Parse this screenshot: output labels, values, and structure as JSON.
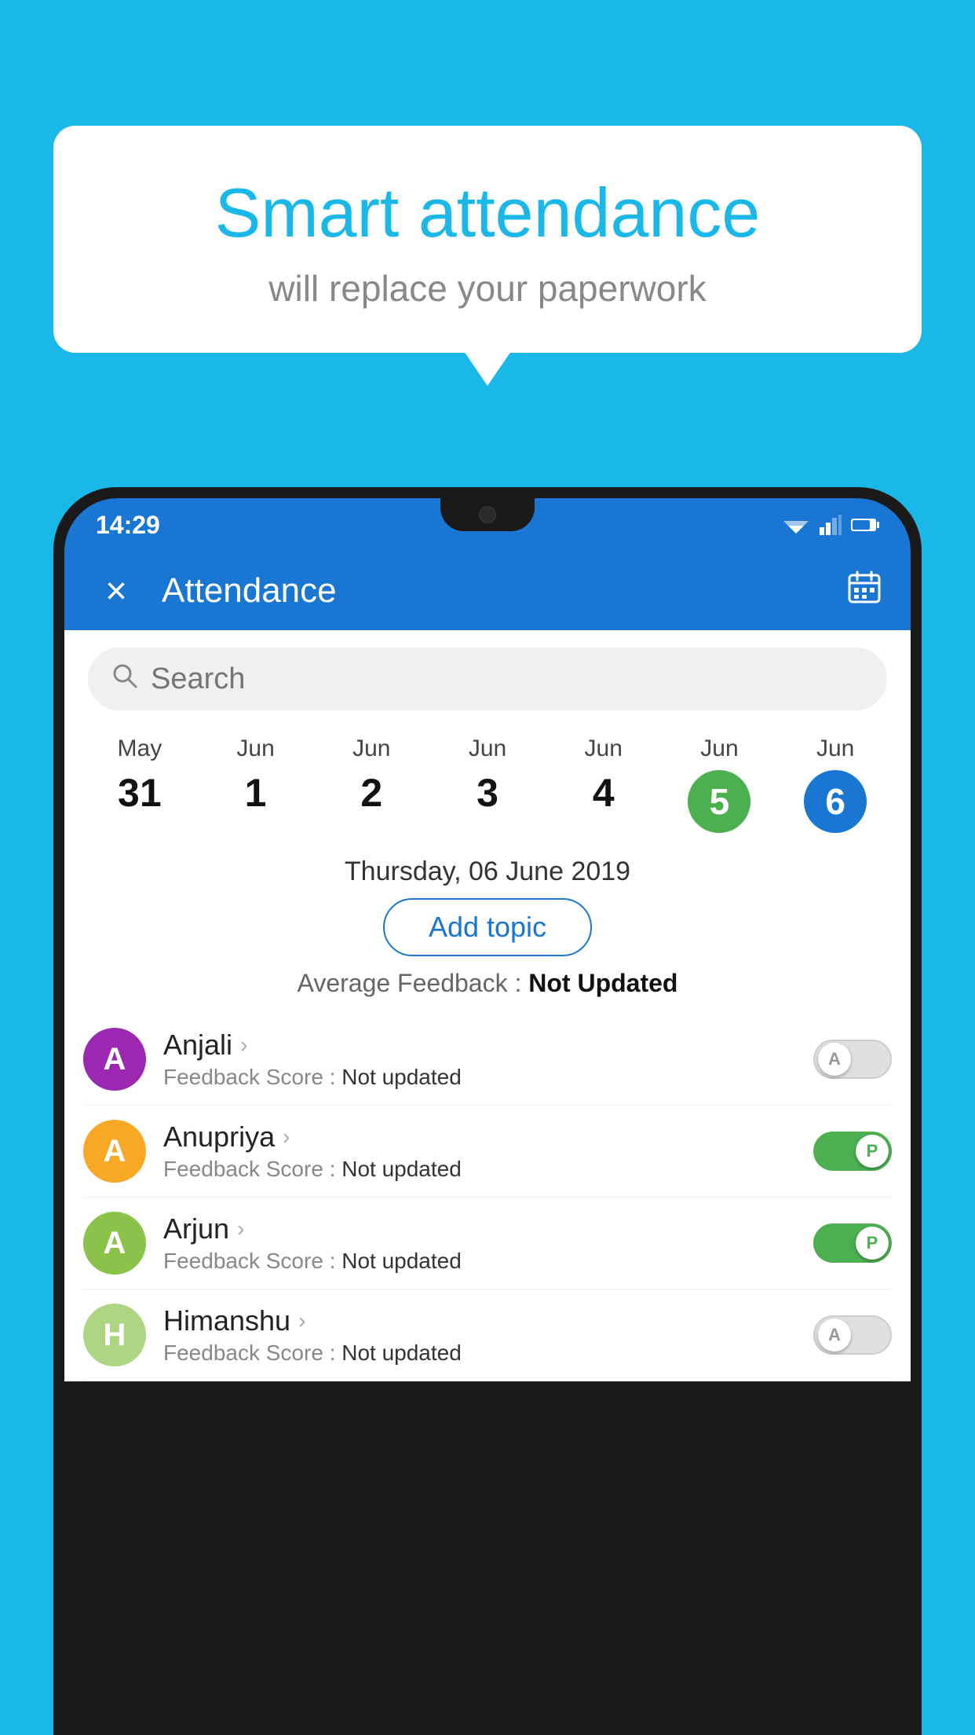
{
  "background_color": "#1ab8e8",
  "bubble": {
    "title": "Smart attendance",
    "subtitle": "will replace your paperwork"
  },
  "status_bar": {
    "time": "14:29"
  },
  "app_bar": {
    "title": "Attendance",
    "close_label": "×"
  },
  "search": {
    "placeholder": "Search"
  },
  "dates": [
    {
      "month": "May",
      "day": "31",
      "selected": false
    },
    {
      "month": "Jun",
      "day": "1",
      "selected": false
    },
    {
      "month": "Jun",
      "day": "2",
      "selected": false
    },
    {
      "month": "Jun",
      "day": "3",
      "selected": false
    },
    {
      "month": "Jun",
      "day": "4",
      "selected": false
    },
    {
      "month": "Jun",
      "day": "5",
      "selected": "green"
    },
    {
      "month": "Jun",
      "day": "6",
      "selected": "blue"
    }
  ],
  "selected_date_text": "Thursday, 06 June 2019",
  "add_topic_label": "Add topic",
  "avg_feedback_label": "Average Feedback :",
  "avg_feedback_value": "Not Updated",
  "students": [
    {
      "name": "Anjali",
      "avatar_letter": "A",
      "avatar_color": "#9c27b0",
      "feedback_label": "Feedback Score :",
      "feedback_value": "Not updated",
      "toggle": "off",
      "toggle_letter": "A"
    },
    {
      "name": "Anupriya",
      "avatar_letter": "A",
      "avatar_color": "#f9a825",
      "feedback_label": "Feedback Score :",
      "feedback_value": "Not updated",
      "toggle": "on",
      "toggle_letter": "P"
    },
    {
      "name": "Arjun",
      "avatar_letter": "A",
      "avatar_color": "#8bc34a",
      "feedback_label": "Feedback Score :",
      "feedback_value": "Not updated",
      "toggle": "on",
      "toggle_letter": "P"
    },
    {
      "name": "Himanshu",
      "avatar_letter": "H",
      "avatar_color": "#aed581",
      "feedback_label": "Feedback Score :",
      "feedback_value": "Not updated",
      "toggle": "off",
      "toggle_letter": "A"
    }
  ]
}
